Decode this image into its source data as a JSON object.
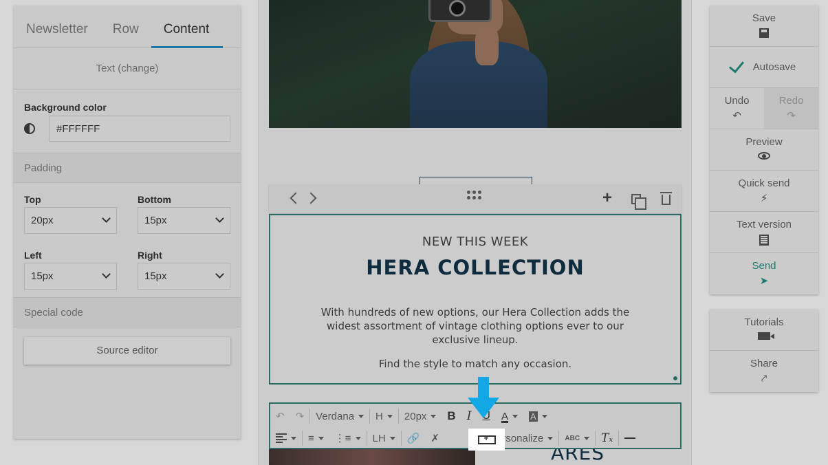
{
  "left_panel": {
    "tabs": [
      "Newsletter",
      "Row",
      "Content"
    ],
    "active_tab": "Content",
    "block_type": "Text (change)",
    "background_color": {
      "label": "Background color",
      "value": "#FFFFFF"
    },
    "padding": {
      "header": "Padding",
      "top": {
        "label": "Top",
        "value": "20px"
      },
      "bottom": {
        "label": "Bottom",
        "value": "15px"
      },
      "left": {
        "label": "Left",
        "value": "15px"
      },
      "right": {
        "label": "Right",
        "value": "15px"
      }
    },
    "special_code": {
      "header": "Special code",
      "button": "Source editor"
    }
  },
  "canvas": {
    "eyebrow": "NEW THIS WEEK",
    "headline": "HERA COLLECTION",
    "paragraph": "With hundreds of new options, our Hera Collection adds the widest assortment of vintage clothing options ever to our exclusive lineup.",
    "paragraph2": "Find the style to match any occasion.",
    "below_title": "ARES"
  },
  "editor_toolbar": {
    "font": "Verdana",
    "heading": "H",
    "size": "20px",
    "line_height": "LH",
    "personalize": "Personalize",
    "highlighted_tool": "insert-button-icon"
  },
  "right_panel": {
    "save": "Save",
    "autosave": "Autosave",
    "undo": "Undo",
    "redo": "Redo",
    "preview": "Preview",
    "quick_send": "Quick send",
    "text_version": "Text version",
    "send": "Send",
    "tutorials": "Tutorials",
    "share": "Share"
  },
  "colors": {
    "accent_teal": "#1f7a70",
    "tab_underline": "#1f7aa8",
    "annotation_arrow": "#12a8e6",
    "headline": "#0f2c3e"
  }
}
